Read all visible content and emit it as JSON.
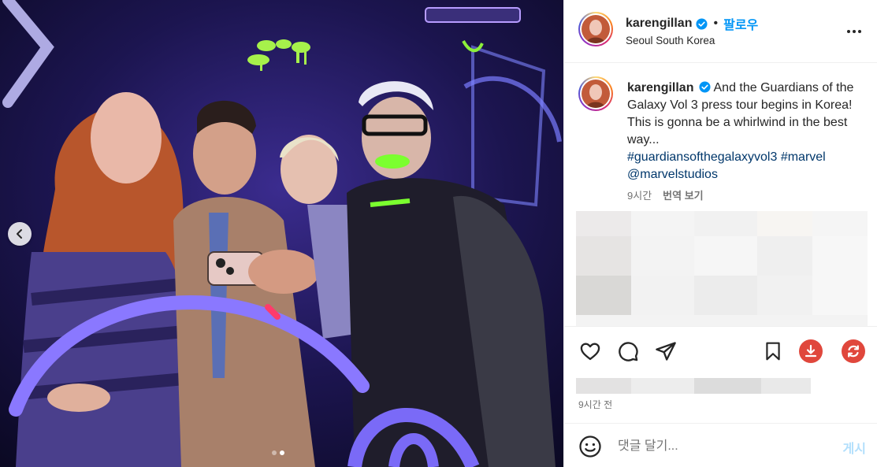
{
  "post": {
    "username": "karengillan",
    "follow_label": "팔로우",
    "bullet": "•",
    "location": "Seoul South Korea",
    "caption_text": "And the Guardians of the Galaxy Vol 3 press tour begins in Korea! This is gonna be a whirlwind in the best way...",
    "hashtags": [
      "#guardiansofthegalaxyvol3",
      "#marvel",
      "@marvelstudios"
    ],
    "caption_age": "9시간",
    "translate_label": "번역 보기",
    "time_ago": "9시간 전"
  },
  "comment_box": {
    "placeholder": "댓글 달기...",
    "post_label": "게시"
  },
  "carousel": {
    "total": 2,
    "active_index": 2
  },
  "icons": {
    "verified": "verified-badge-icon",
    "more": "more-options-icon",
    "like": "heart-icon",
    "comment": "comment-bubble-icon",
    "share": "paper-plane-icon",
    "save": "bookmark-icon",
    "download": "download-icon",
    "refresh": "refresh-icon",
    "emoji": "smiley-icon",
    "prev": "chevron-left-icon"
  },
  "colors": {
    "accent": "#0095f6",
    "hashtag": "#00376b",
    "download_button": "#e0473c",
    "refresh_button": "#e0473c",
    "post_disabled": "#b2dffc"
  }
}
